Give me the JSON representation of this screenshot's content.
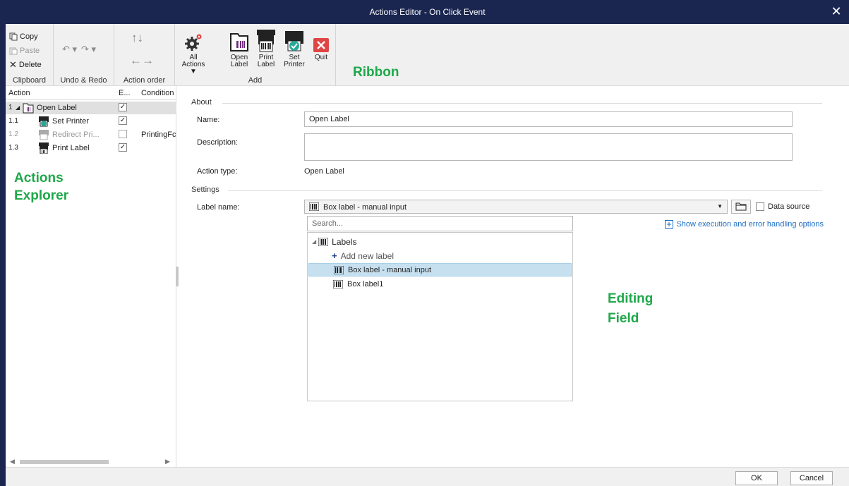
{
  "window": {
    "title": "Actions Editor - On Click Event"
  },
  "ribbon": {
    "clipboard": {
      "copy": "Copy",
      "paste": "Paste",
      "delete": "Delete",
      "label": "Clipboard"
    },
    "undo_redo": {
      "label": "Undo & Redo"
    },
    "action_order": {
      "label": "Action order"
    },
    "add": {
      "label": "Add",
      "all_actions_1": "All",
      "all_actions_2": "Actions",
      "open_label_1": "Open",
      "open_label_2": "Label",
      "print_label_1": "Print",
      "print_label_2": "Label",
      "set_printer_1": "Set",
      "set_printer_2": "Printer",
      "quit": "Quit"
    },
    "callout": "Ribbon"
  },
  "explorer": {
    "headers": {
      "action": "Action",
      "enabled": "E...",
      "condition": "Condition"
    },
    "rows": [
      {
        "num": "1",
        "name": "Open Label",
        "checked": true,
        "condition": ""
      },
      {
        "num": "1.1",
        "name": "Set Printer",
        "checked": true,
        "condition": ""
      },
      {
        "num": "1.2",
        "name": "Redirect Pri...",
        "checked": false,
        "condition": "PrintingFc"
      },
      {
        "num": "1.3",
        "name": "Print Label",
        "checked": true,
        "condition": ""
      }
    ],
    "callout_1": "Actions",
    "callout_2": "Explorer"
  },
  "editor": {
    "about": "About",
    "name_label": "Name:",
    "name_value": "Open Label",
    "description_label": "Description:",
    "description_value": "",
    "action_type_label": "Action type:",
    "action_type_value": "Open Label",
    "settings": "Settings",
    "label_name_label": "Label name:",
    "label_name_value": "Box label - manual input",
    "data_source": "Data source",
    "exec_link": "Show execution and error handling options",
    "search_placeholder": "Search...",
    "tree": {
      "root": "Labels",
      "add_new": "Add new label",
      "items": [
        "Box label - manual input",
        "Box label1"
      ]
    },
    "callout_1": "Editing",
    "callout_2": "Field"
  },
  "footer": {
    "ok": "OK",
    "cancel": "Cancel"
  },
  "colors": {
    "titlebar": "#1a2650",
    "callout": "#1fa84a",
    "link": "#1e6fc5",
    "selection": "#c6e0f0"
  }
}
